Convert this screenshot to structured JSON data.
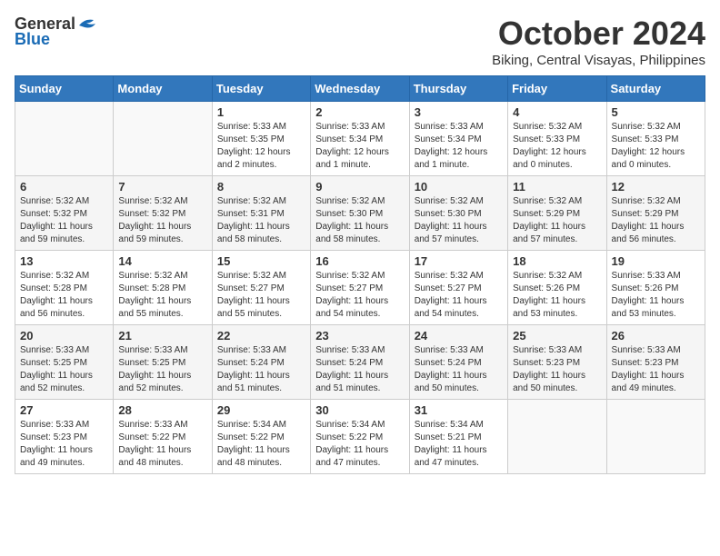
{
  "logo": {
    "text_general": "General",
    "text_blue": "Blue"
  },
  "title": "October 2024",
  "location": "Biking, Central Visayas, Philippines",
  "headers": [
    "Sunday",
    "Monday",
    "Tuesday",
    "Wednesday",
    "Thursday",
    "Friday",
    "Saturday"
  ],
  "weeks": [
    [
      {
        "day": "",
        "info": ""
      },
      {
        "day": "",
        "info": ""
      },
      {
        "day": "1",
        "info": "Sunrise: 5:33 AM\nSunset: 5:35 PM\nDaylight: 12 hours\nand 2 minutes."
      },
      {
        "day": "2",
        "info": "Sunrise: 5:33 AM\nSunset: 5:34 PM\nDaylight: 12 hours\nand 1 minute."
      },
      {
        "day": "3",
        "info": "Sunrise: 5:33 AM\nSunset: 5:34 PM\nDaylight: 12 hours\nand 1 minute."
      },
      {
        "day": "4",
        "info": "Sunrise: 5:32 AM\nSunset: 5:33 PM\nDaylight: 12 hours\nand 0 minutes."
      },
      {
        "day": "5",
        "info": "Sunrise: 5:32 AM\nSunset: 5:33 PM\nDaylight: 12 hours\nand 0 minutes."
      }
    ],
    [
      {
        "day": "6",
        "info": "Sunrise: 5:32 AM\nSunset: 5:32 PM\nDaylight: 11 hours\nand 59 minutes."
      },
      {
        "day": "7",
        "info": "Sunrise: 5:32 AM\nSunset: 5:32 PM\nDaylight: 11 hours\nand 59 minutes."
      },
      {
        "day": "8",
        "info": "Sunrise: 5:32 AM\nSunset: 5:31 PM\nDaylight: 11 hours\nand 58 minutes."
      },
      {
        "day": "9",
        "info": "Sunrise: 5:32 AM\nSunset: 5:30 PM\nDaylight: 11 hours\nand 58 minutes."
      },
      {
        "day": "10",
        "info": "Sunrise: 5:32 AM\nSunset: 5:30 PM\nDaylight: 11 hours\nand 57 minutes."
      },
      {
        "day": "11",
        "info": "Sunrise: 5:32 AM\nSunset: 5:29 PM\nDaylight: 11 hours\nand 57 minutes."
      },
      {
        "day": "12",
        "info": "Sunrise: 5:32 AM\nSunset: 5:29 PM\nDaylight: 11 hours\nand 56 minutes."
      }
    ],
    [
      {
        "day": "13",
        "info": "Sunrise: 5:32 AM\nSunset: 5:28 PM\nDaylight: 11 hours\nand 56 minutes."
      },
      {
        "day": "14",
        "info": "Sunrise: 5:32 AM\nSunset: 5:28 PM\nDaylight: 11 hours\nand 55 minutes."
      },
      {
        "day": "15",
        "info": "Sunrise: 5:32 AM\nSunset: 5:27 PM\nDaylight: 11 hours\nand 55 minutes."
      },
      {
        "day": "16",
        "info": "Sunrise: 5:32 AM\nSunset: 5:27 PM\nDaylight: 11 hours\nand 54 minutes."
      },
      {
        "day": "17",
        "info": "Sunrise: 5:32 AM\nSunset: 5:27 PM\nDaylight: 11 hours\nand 54 minutes."
      },
      {
        "day": "18",
        "info": "Sunrise: 5:32 AM\nSunset: 5:26 PM\nDaylight: 11 hours\nand 53 minutes."
      },
      {
        "day": "19",
        "info": "Sunrise: 5:33 AM\nSunset: 5:26 PM\nDaylight: 11 hours\nand 53 minutes."
      }
    ],
    [
      {
        "day": "20",
        "info": "Sunrise: 5:33 AM\nSunset: 5:25 PM\nDaylight: 11 hours\nand 52 minutes."
      },
      {
        "day": "21",
        "info": "Sunrise: 5:33 AM\nSunset: 5:25 PM\nDaylight: 11 hours\nand 52 minutes."
      },
      {
        "day": "22",
        "info": "Sunrise: 5:33 AM\nSunset: 5:24 PM\nDaylight: 11 hours\nand 51 minutes."
      },
      {
        "day": "23",
        "info": "Sunrise: 5:33 AM\nSunset: 5:24 PM\nDaylight: 11 hours\nand 51 minutes."
      },
      {
        "day": "24",
        "info": "Sunrise: 5:33 AM\nSunset: 5:24 PM\nDaylight: 11 hours\nand 50 minutes."
      },
      {
        "day": "25",
        "info": "Sunrise: 5:33 AM\nSunset: 5:23 PM\nDaylight: 11 hours\nand 50 minutes."
      },
      {
        "day": "26",
        "info": "Sunrise: 5:33 AM\nSunset: 5:23 PM\nDaylight: 11 hours\nand 49 minutes."
      }
    ],
    [
      {
        "day": "27",
        "info": "Sunrise: 5:33 AM\nSunset: 5:23 PM\nDaylight: 11 hours\nand 49 minutes."
      },
      {
        "day": "28",
        "info": "Sunrise: 5:33 AM\nSunset: 5:22 PM\nDaylight: 11 hours\nand 48 minutes."
      },
      {
        "day": "29",
        "info": "Sunrise: 5:34 AM\nSunset: 5:22 PM\nDaylight: 11 hours\nand 48 minutes."
      },
      {
        "day": "30",
        "info": "Sunrise: 5:34 AM\nSunset: 5:22 PM\nDaylight: 11 hours\nand 47 minutes."
      },
      {
        "day": "31",
        "info": "Sunrise: 5:34 AM\nSunset: 5:21 PM\nDaylight: 11 hours\nand 47 minutes."
      },
      {
        "day": "",
        "info": ""
      },
      {
        "day": "",
        "info": ""
      }
    ]
  ]
}
